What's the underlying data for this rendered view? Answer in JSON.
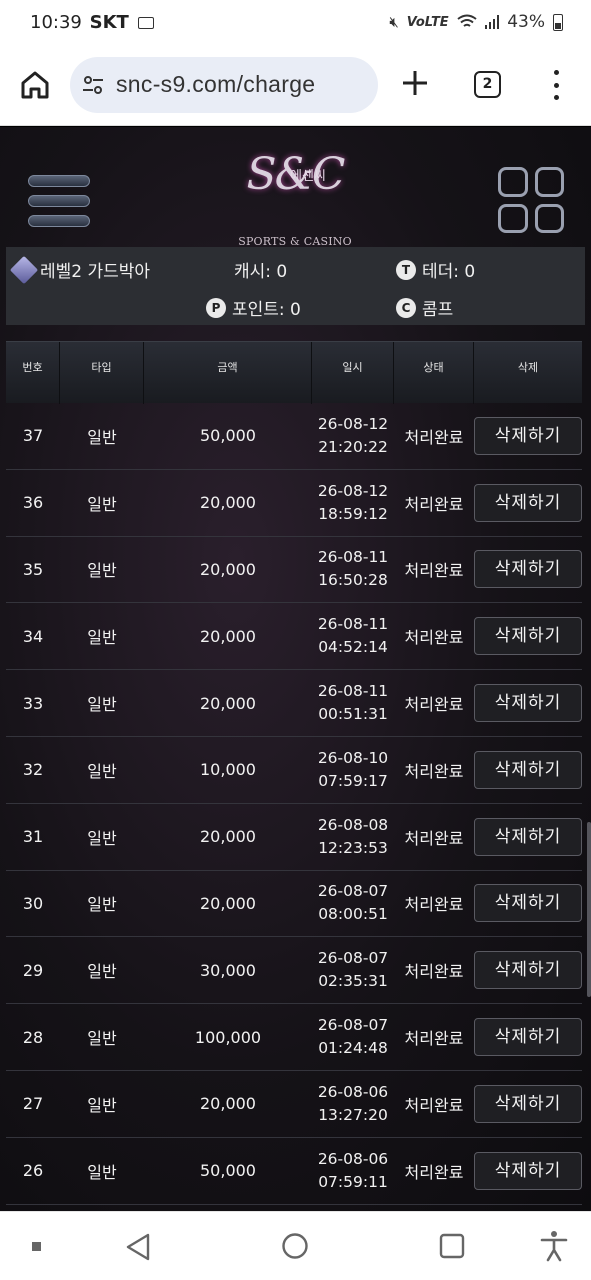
{
  "status_bar": {
    "time": "10:39",
    "carrier": "SKT",
    "volte": "VoLTE",
    "battery": "43%"
  },
  "browser": {
    "url": "snc-s9.com/charge",
    "tab_count": "2"
  },
  "logo": {
    "monogram": "S&C",
    "korean": "에센씨",
    "subtitle": "SPORTS & CASINO"
  },
  "user": {
    "level": "레벨2 가드박아",
    "cash": "캐시: 0",
    "tether": "테더: 0",
    "points": "포인트: 0",
    "comp": "콤프",
    "tether_badge": "T",
    "points_badge": "P",
    "comp_badge": "C"
  },
  "table": {
    "headers": {
      "no": "번호",
      "type": "타입",
      "amount": "금액",
      "datetime": "일시",
      "status": "상태",
      "delete": "삭제"
    },
    "rows": [
      {
        "no": "37",
        "type": "일반",
        "amount": "50,000",
        "date": "26-08-12",
        "time": "21:20:22",
        "status": "처리완료",
        "action": "삭제하기"
      },
      {
        "no": "36",
        "type": "일반",
        "amount": "20,000",
        "date": "26-08-12",
        "time": "18:59:12",
        "status": "처리완료",
        "action": "삭제하기"
      },
      {
        "no": "35",
        "type": "일반",
        "amount": "20,000",
        "date": "26-08-11",
        "time": "16:50:28",
        "status": "처리완료",
        "action": "삭제하기"
      },
      {
        "no": "34",
        "type": "일반",
        "amount": "20,000",
        "date": "26-08-11",
        "time": "04:52:14",
        "status": "처리완료",
        "action": "삭제하기"
      },
      {
        "no": "33",
        "type": "일반",
        "amount": "20,000",
        "date": "26-08-11",
        "time": "00:51:31",
        "status": "처리완료",
        "action": "삭제하기"
      },
      {
        "no": "32",
        "type": "일반",
        "amount": "10,000",
        "date": "26-08-10",
        "time": "07:59:17",
        "status": "처리완료",
        "action": "삭제하기"
      },
      {
        "no": "31",
        "type": "일반",
        "amount": "20,000",
        "date": "26-08-08",
        "time": "12:23:53",
        "status": "처리완료",
        "action": "삭제하기"
      },
      {
        "no": "30",
        "type": "일반",
        "amount": "20,000",
        "date": "26-08-07",
        "time": "08:00:51",
        "status": "처리완료",
        "action": "삭제하기"
      },
      {
        "no": "29",
        "type": "일반",
        "amount": "30,000",
        "date": "26-08-07",
        "time": "02:35:31",
        "status": "처리완료",
        "action": "삭제하기"
      },
      {
        "no": "28",
        "type": "일반",
        "amount": "100,000",
        "date": "26-08-07",
        "time": "01:24:48",
        "status": "처리완료",
        "action": "삭제하기"
      },
      {
        "no": "27",
        "type": "일반",
        "amount": "20,000",
        "date": "26-08-06",
        "time": "13:27:20",
        "status": "처리완료",
        "action": "삭제하기"
      },
      {
        "no": "26",
        "type": "일반",
        "amount": "50,000",
        "date": "26-08-06",
        "time": "07:59:11",
        "status": "처리완료",
        "action": "삭제하기"
      }
    ]
  },
  "icons": {
    "home": "home-icon",
    "tune": "tune-icon",
    "plus": "plus-icon",
    "tabs": "tabs-icon",
    "menu": "more-vert-icon",
    "hamburger": "hamburger-menu-icon",
    "grid": "grid-menu-icon",
    "nav": [
      "back-icon",
      "home-circle-icon",
      "recents-icon",
      "accessibility-icon"
    ]
  },
  "colors": {
    "page_bg": "#151217",
    "userbar_bg": "#2c2e33",
    "row_border": "#34343c",
    "button_border": "#5a5a62"
  }
}
